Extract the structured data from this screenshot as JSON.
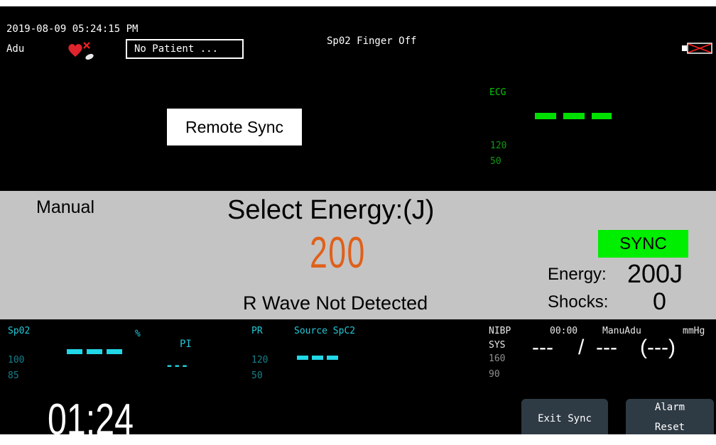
{
  "header": {
    "datetime": "2019-08-09 05:24:15 PM",
    "patient_type": "Adu",
    "patient_name": "No Patient ...",
    "alarm_message": "Sp02  Finger Off"
  },
  "ecg": {
    "label": "ECG",
    "value": "---",
    "upper_limit": "120",
    "lower_limit": "50"
  },
  "remote_sync_label": "Remote Sync",
  "energy_panel": {
    "mode": "Manual",
    "select_energy_label": "Select Energy:(J)",
    "selected_energy": "200",
    "r_wave_message": "R Wave Not Detected",
    "sync_label": "SYNC",
    "energy_label": "Energy:",
    "energy_value": "200J",
    "shocks_label": "Shocks:",
    "shocks_value": "0"
  },
  "spo2": {
    "label": "Sp02",
    "unit": "%",
    "value": "---",
    "upper_limit": "100",
    "lower_limit": "85",
    "pi_label": "PI",
    "pi_value": "---"
  },
  "pr": {
    "label": "PR",
    "source_label": "Source SpC2",
    "value": "---",
    "upper_limit": "120",
    "lower_limit": "50"
  },
  "nibp": {
    "label": "NIBP",
    "sub_label": "SYS",
    "time": "00:00",
    "mode": "ManuAdu",
    "unit": "mmHg",
    "upper_limit": "160",
    "lower_limit": "90",
    "systolic": "---",
    "separator": "/",
    "diastolic": "---",
    "mean": "(---)"
  },
  "timer": "01:24",
  "buttons": {
    "exit_sync": "Exit Sync",
    "alarm_reset_line1": "Alarm",
    "alarm_reset_line2": "Reset"
  },
  "colors": {
    "ecg": "#00c800",
    "spo2": "#22c8d8",
    "energy_value": "#e0601a",
    "sync_badge": "#00ee00"
  }
}
